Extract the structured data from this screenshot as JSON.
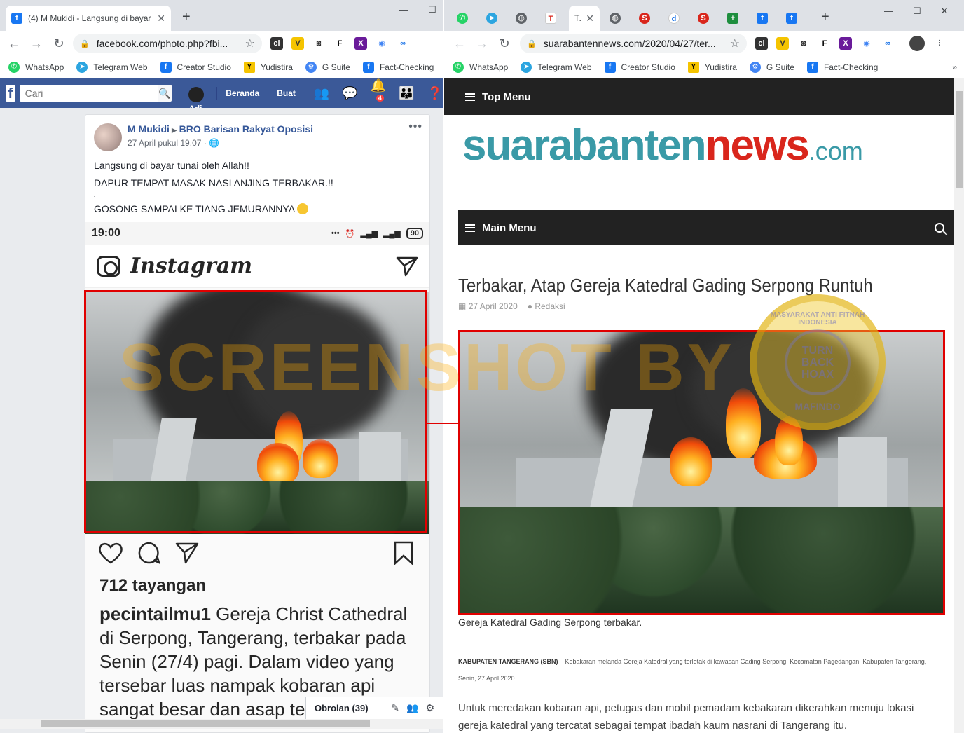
{
  "left_window": {
    "tab_title": "(4) M Mukidi - Langsung di bayar",
    "url": "facebook.com/photo.php?fbi...",
    "bookmarks": [
      "WhatsApp",
      "Telegram Web",
      "Creator Studio",
      "Yudistira",
      "G Suite",
      "Fact-Checking"
    ],
    "facebook": {
      "search_placeholder": "Cari",
      "user_name": "Adi",
      "nav_home": "Beranda",
      "nav_create": "Buat",
      "notif_count": "4"
    },
    "post": {
      "author": "M Mukidi",
      "group": "BRO Barisan Rakyat Oposisi",
      "time": "27 April pukul 19.07",
      "line1": "Langsung di bayar tunai oleh Allah!!",
      "line2": "DAPUR TEMPAT MASAK NASI ANJING TERBAKAR.!!",
      "line3": ".",
      "line4": "GOSONG SAMPAI KE TIANG JEMURANNYA",
      "ig": {
        "time": "19:00",
        "battery": "90",
        "logo": "Instagram",
        "views": "712 tayangan",
        "caption_user": "pecintailmu1",
        "caption": "Gereja Christ Cathedral di Serpong, Tangerang, terbakar pada Senin (27/4) pagi. Dalam video yang tersebar luas nampak kobaran api sangat besar dan asap te"
      }
    },
    "chat_label": "Obrolan (39)"
  },
  "right_window": {
    "active_tab": "Te",
    "url": "suarabantennews.com/2020/04/27/ter...",
    "bookmarks": [
      "WhatsApp",
      "Telegram Web",
      "Creator Studio",
      "Yudistira",
      "G Suite",
      "Fact-Checking"
    ],
    "site": {
      "top_menu": "Top Menu",
      "logo_a": "suarabanten",
      "logo_b": "news",
      "logo_c": ".com",
      "main_menu": "Main Menu",
      "title": "Terbakar, Atap Gereja Katedral Gading Serpong Runtuh",
      "date": "27 April 2020",
      "author": "Redaksi",
      "caption": "Gereja Katedral Gading Serpong terbakar.",
      "lead_bold": "KABUPATEN TANGERANG (SBN) –",
      "lead_text": "Kebakaran melanda Gereja Katedral yang terletak di kawasan Gading Serpong, Kecamatan Pagedangan, Kabupaten Tangerang, Senin, 27 April 2020.",
      "para2": "Untuk meredakan kobaran api, petugas dan mobil pemadam kebakaran dikerahkan menuju lokasi gereja katedral yang tercatat sebagai tempat ibadah kaum nasrani di Tangerang itu."
    }
  },
  "overlay": {
    "watermark": "SCREENSHOT BY",
    "seal_ring": "MASYARAKAT ANTI FITNAH INDONESIA",
    "seal_l1": "TURN",
    "seal_l2": "BACK",
    "seal_l3": "HOAX",
    "seal_bottom": "MAFINDO"
  },
  "colors": {
    "fb_blue": "#3b5998",
    "highlight_red": "#e00000",
    "site_teal": "#3a9aa7",
    "site_red": "#d9261c"
  }
}
